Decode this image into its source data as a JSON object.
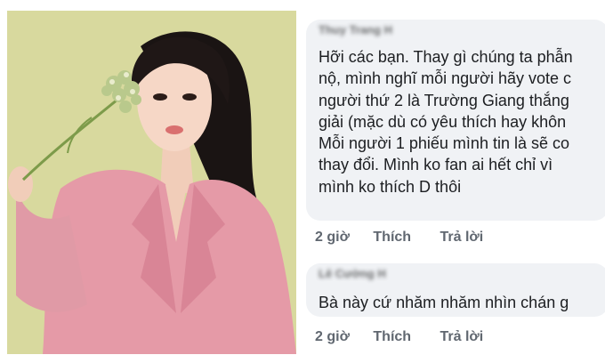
{
  "photo": {
    "description_icon": "portrait-photo"
  },
  "comments": [
    {
      "author": "Thuy Trang H",
      "text": "Hỡi các bạn. Thay gì chúng ta phẫn\nnộ, mình nghĩ mỗi người hãy vote c\nngười thứ 2 là Trường Giang thắng\ngiải (mặc dù có yêu thích hay khôn\nMỗi người 1 phiếu mình tin là sẽ co\nthay đổi. Mình ko fan ai hết chỉ vì\nmình ko thích D thôi",
      "time": "2 giờ",
      "like": "Thích",
      "reply": "Trả lời"
    },
    {
      "author": "Lê Cường H",
      "text": "Bà này cứ nhăm nhăm nhìn chán g",
      "time": "2 giờ",
      "like": "Thích",
      "reply": "Trả lời"
    }
  ],
  "colors": {
    "bubble": "#f0f2f5",
    "text": "#1c1e21",
    "action": "#606770",
    "photo_background": "#d9d9a0",
    "blazer": "#e59aa7"
  }
}
